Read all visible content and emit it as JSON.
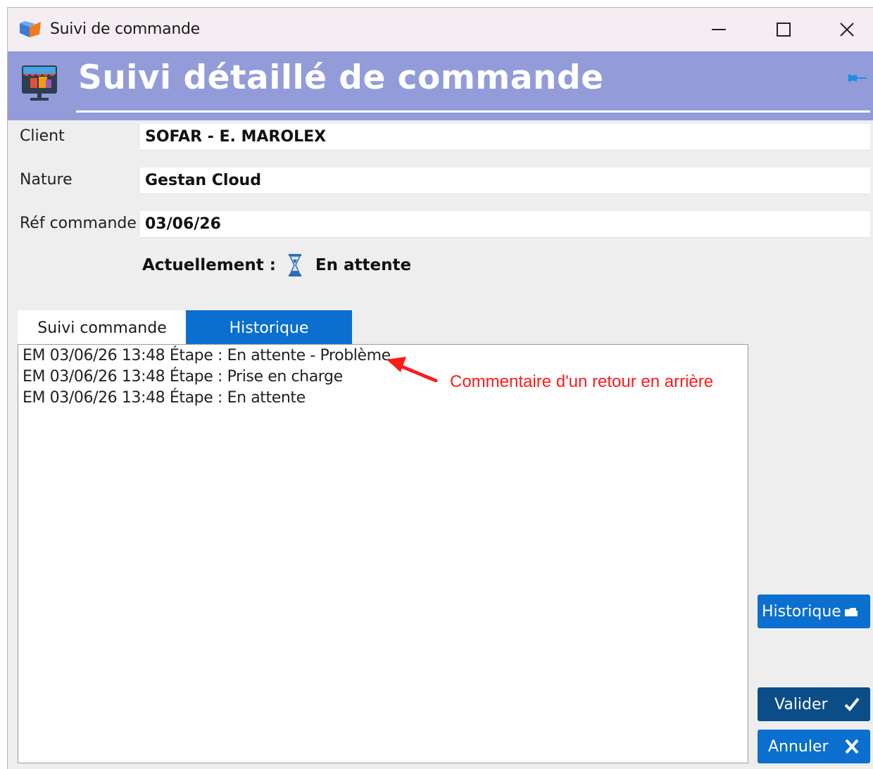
{
  "window": {
    "title": "Suivi de commande"
  },
  "banner": {
    "title": "Suivi détaillé de commande"
  },
  "form": {
    "client_label": "Client",
    "client_value": "SOFAR - E. MAROLEX",
    "nature_label": "Nature",
    "nature_value": "Gestan Cloud",
    "ref_label": "Réf commande",
    "ref_value": "03/06/26",
    "status_label": "Actuellement :",
    "status_value": "En attente",
    "status_icon": "hourglass-icon"
  },
  "tabs": [
    {
      "label": "Suivi commande",
      "active": false
    },
    {
      "label": "Historique",
      "active": true
    }
  ],
  "history": [
    "EM 03/06/26 13:48 Étape : En attente - Problème",
    "EM 03/06/26 13:48 Étape : Prise en charge",
    "EM 03/06/26 13:48 Étape : En attente"
  ],
  "annotation": {
    "text": "Commentaire d'un retour en arrière",
    "color": "#ff1a1a"
  },
  "buttons": {
    "historique": "Historique",
    "valider": "Valider",
    "annuler": "Annuler"
  },
  "colors": {
    "banner": "#939cd9",
    "accent_blue": "#0a6fcf",
    "dark_blue": "#0b4d86"
  }
}
